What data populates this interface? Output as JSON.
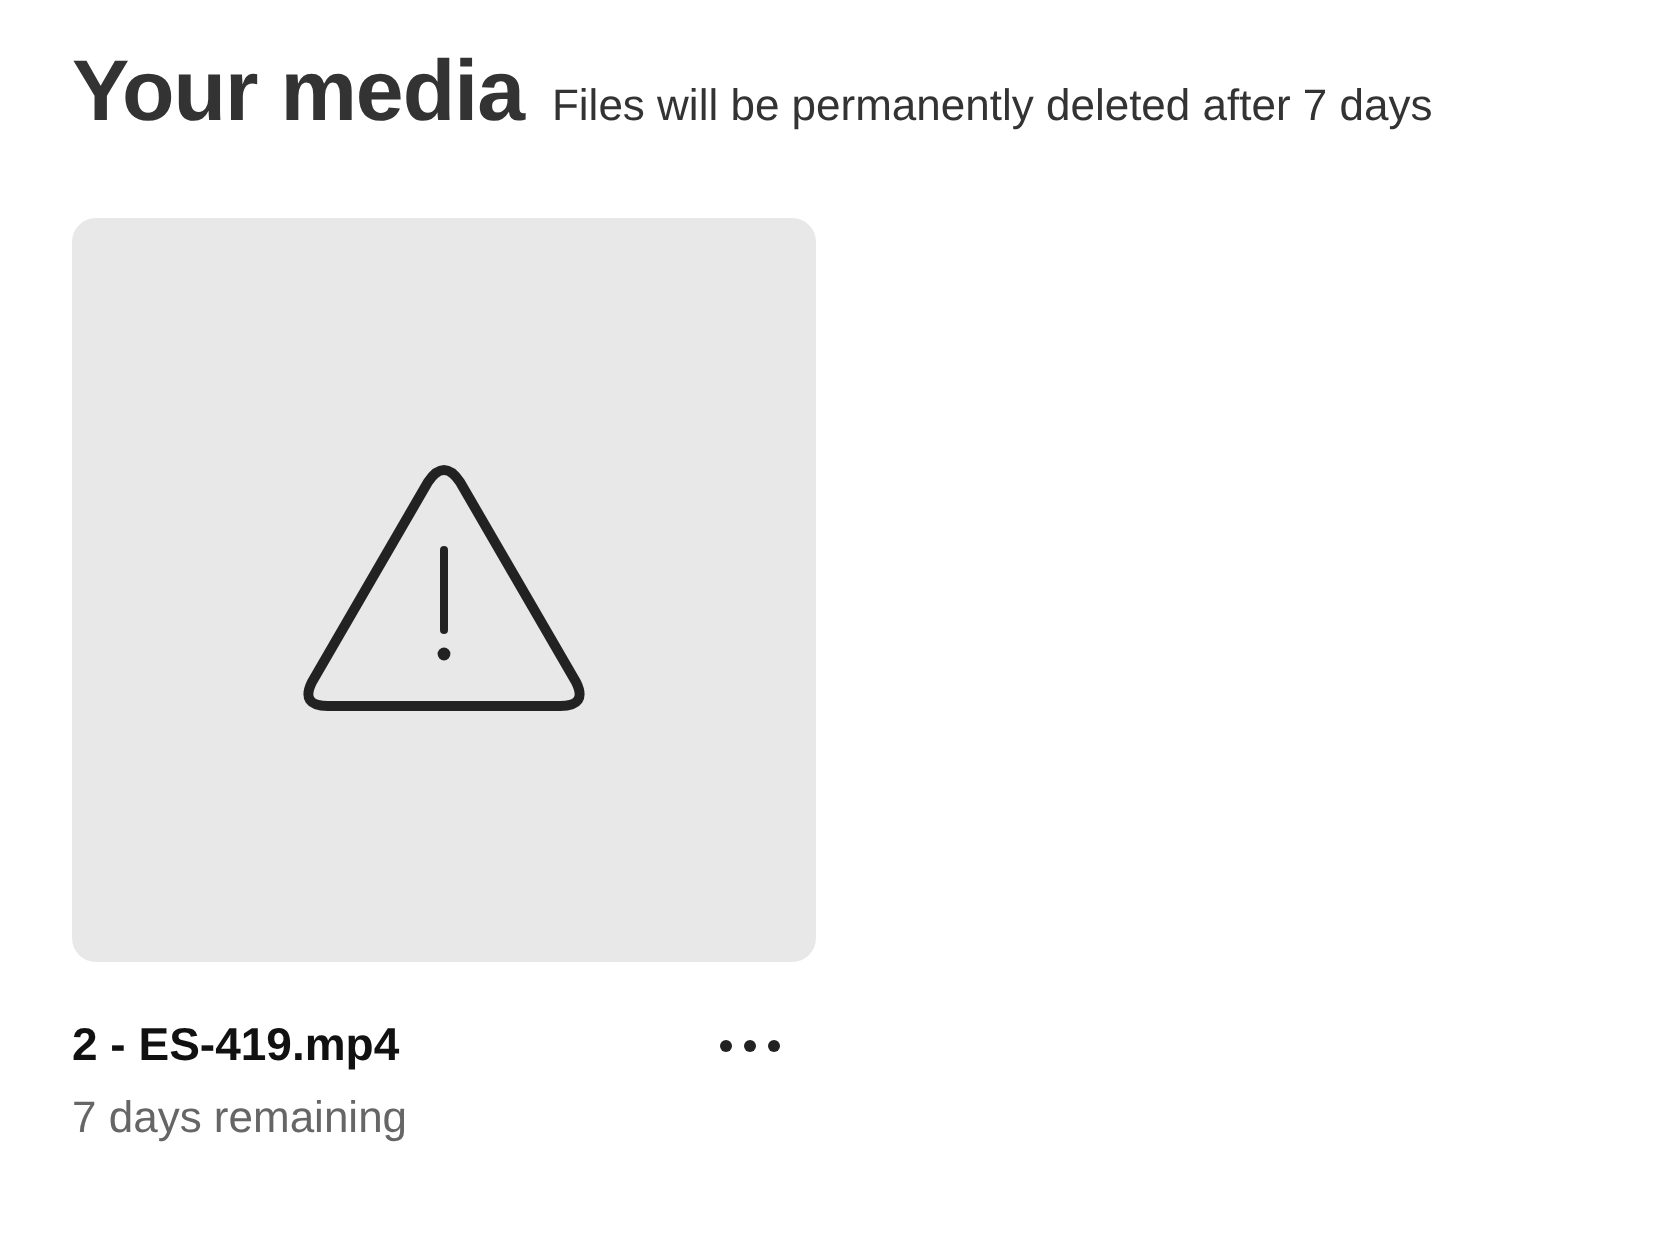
{
  "header": {
    "title": "Your media",
    "subtitle": "Files will be permanently deleted after 7 days"
  },
  "items": [
    {
      "kind": "warning",
      "name": "2 - ES-419.mp4",
      "remaining": "7 days remaining"
    }
  ]
}
